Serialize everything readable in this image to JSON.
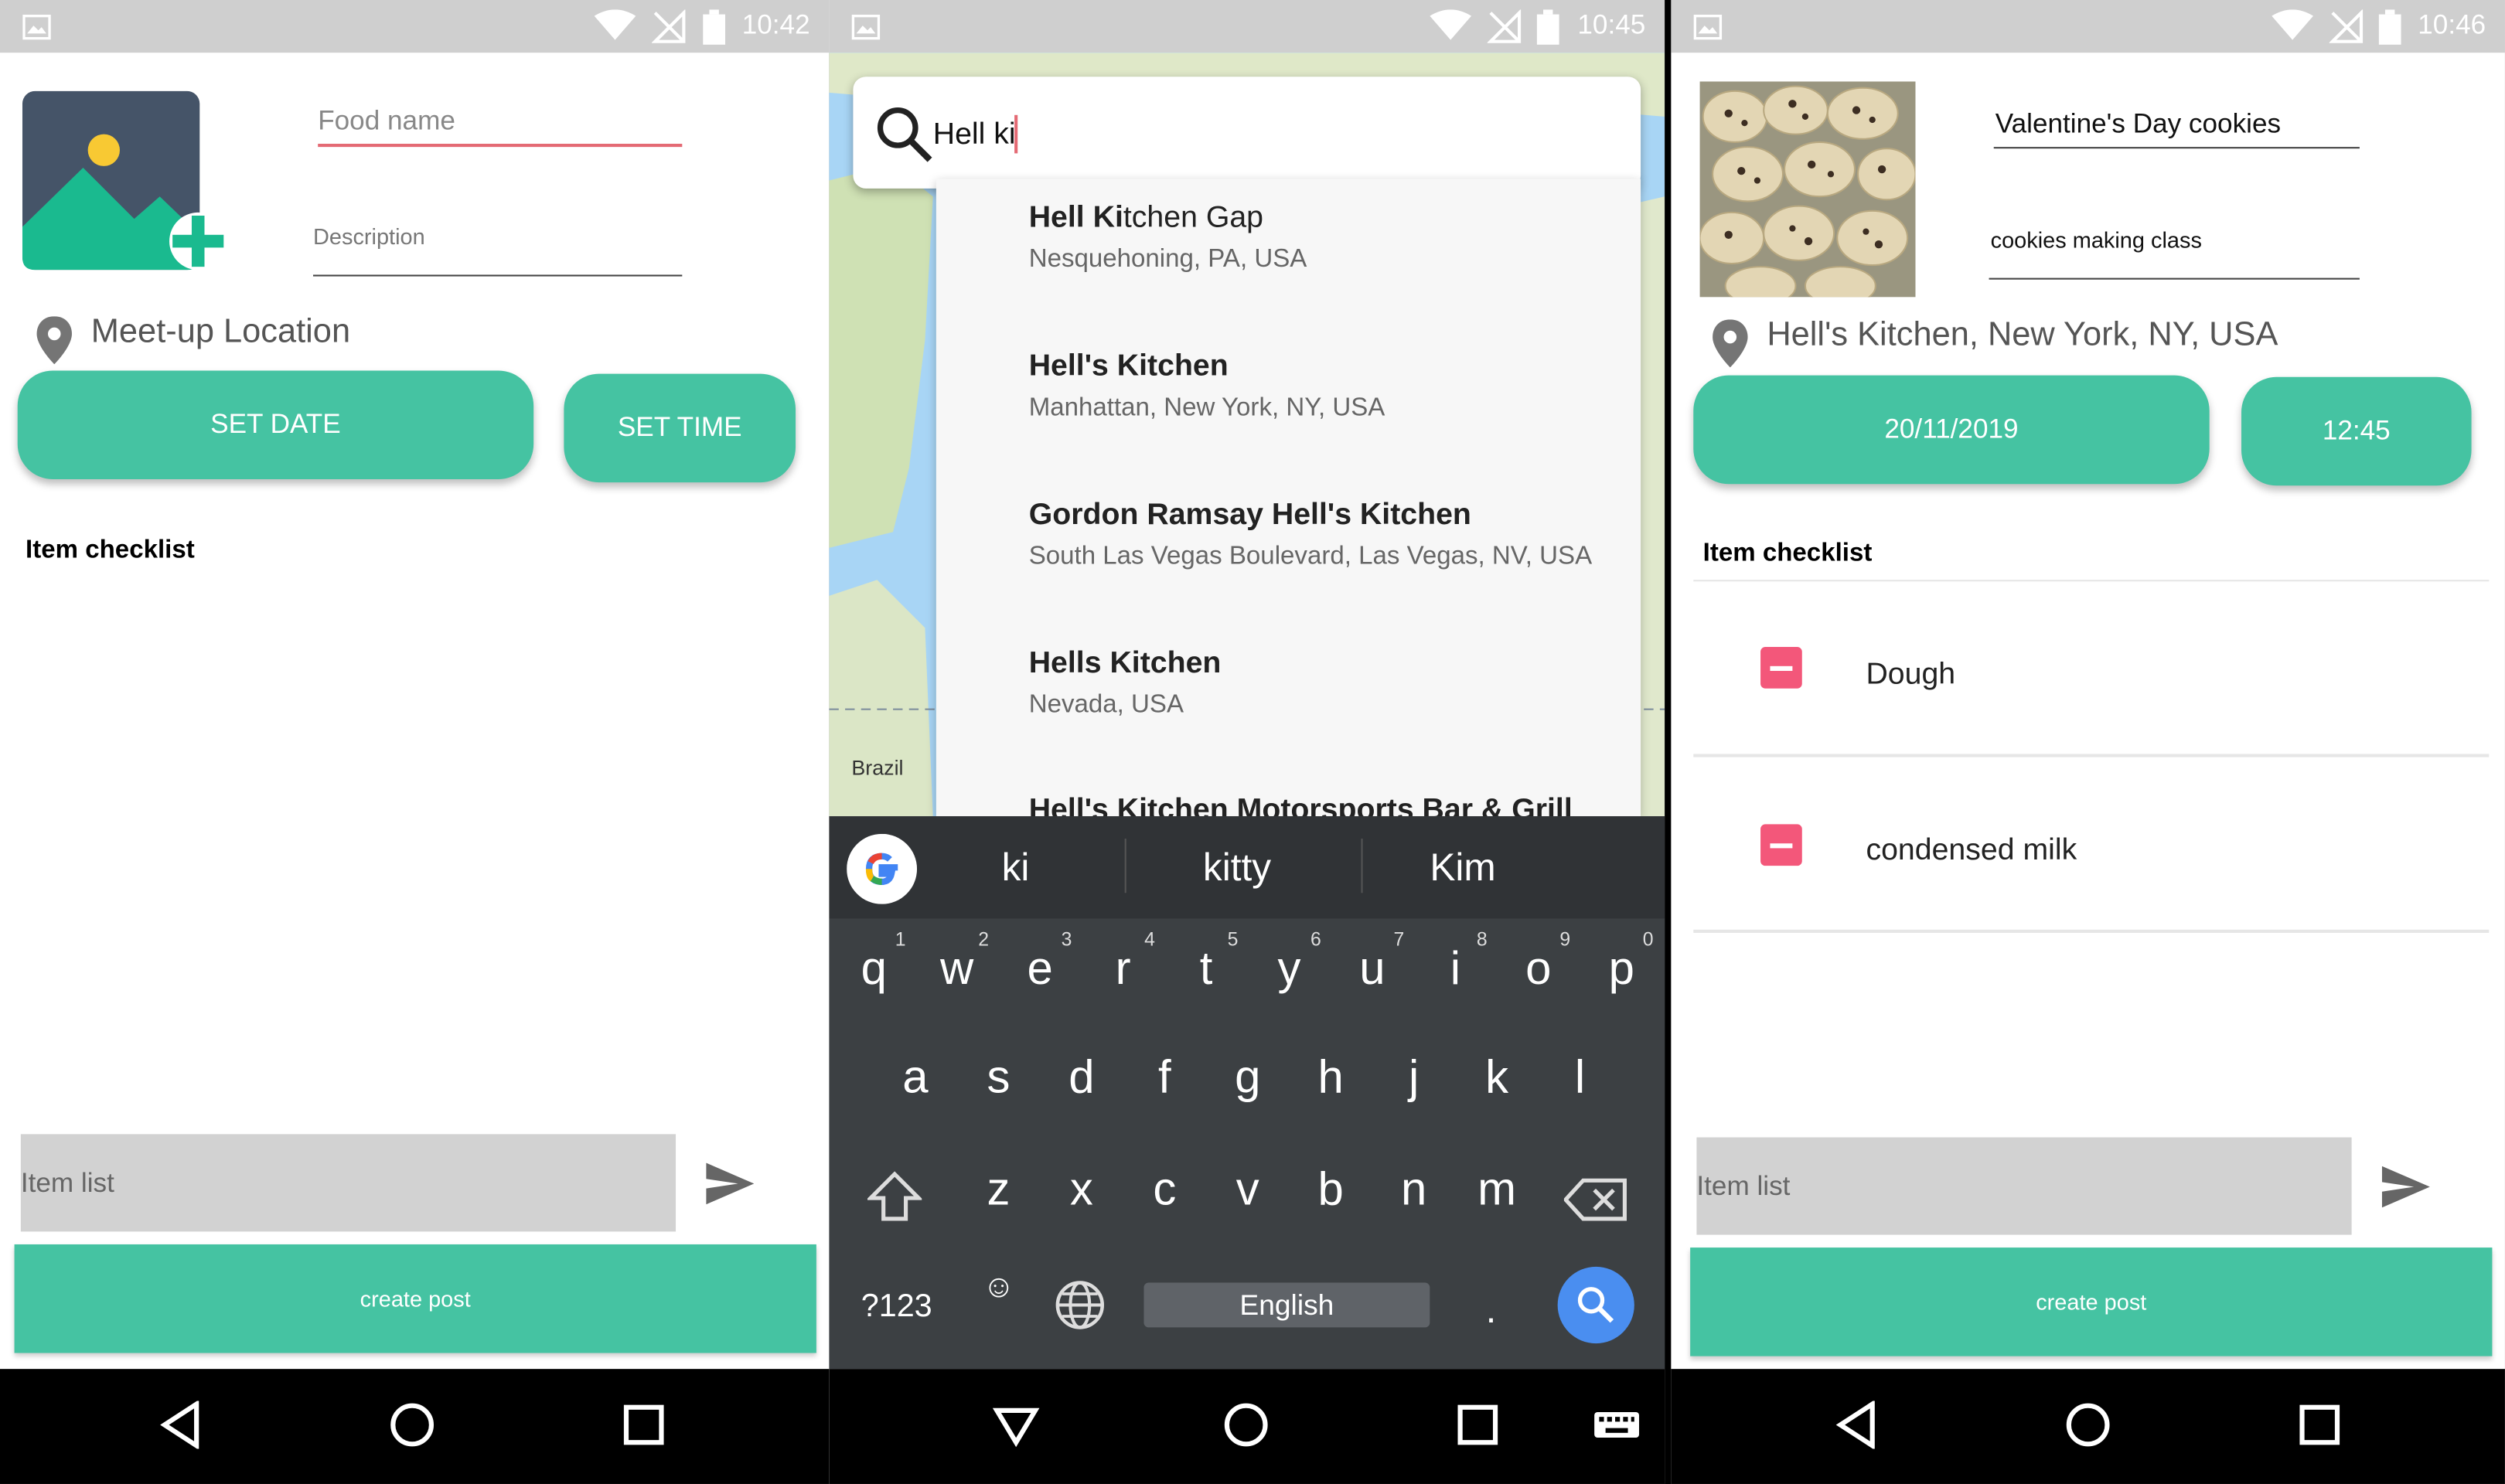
{
  "screens": [
    {
      "status_time": "10:42",
      "food_name_placeholder": "Food name",
      "description_placeholder": "Description",
      "location": "Meet-up Location",
      "set_date": "SET DATE",
      "set_time": "SET TIME",
      "checklist_title": "Item checklist",
      "item_list_placeholder": "Item list",
      "create_post": "create post"
    },
    {
      "status_time": "10:45",
      "search_query": "Hell ki",
      "suggestions": [
        {
          "bold": "Hell Ki",
          "rest": "tchen Gap",
          "sub": "Nesquehoning, PA, USA"
        },
        {
          "bold": "Hell's Kitchen",
          "rest": "",
          "sub": "Manhattan, New York, NY, USA"
        },
        {
          "bold": "Gordon Ramsay Hell's Kitchen",
          "rest": "",
          "sub": "South Las Vegas Boulevard, Las Vegas, NV, USA"
        },
        {
          "bold": "Hells Kitchen",
          "rest": "",
          "sub": "Nevada, USA"
        },
        {
          "bold": "Hell's Kitchen Motorsports Bar & Grill",
          "rest": "",
          "sub": ""
        }
      ],
      "map_label": "Brazil",
      "keyboard": {
        "suggestions": [
          "ki",
          "kitty",
          "Kim"
        ],
        "row1": [
          "q",
          "w",
          "e",
          "r",
          "t",
          "y",
          "u",
          "i",
          "o",
          "p"
        ],
        "row1_nums": [
          "1",
          "2",
          "3",
          "4",
          "5",
          "6",
          "7",
          "8",
          "9",
          "0"
        ],
        "row2": [
          "a",
          "s",
          "d",
          "f",
          "g",
          "h",
          "j",
          "k",
          "l"
        ],
        "row3": [
          "z",
          "x",
          "c",
          "v",
          "b",
          "n",
          "m"
        ],
        "symbols": "?123",
        "space": "English",
        "period": "."
      }
    },
    {
      "status_time": "10:46",
      "food_name": "Valentine's Day cookies",
      "description": "cookies making class",
      "location": "Hell's Kitchen, New York, NY, USA",
      "date": "20/11/2019",
      "time": "12:45",
      "checklist_title": "Item checklist",
      "items": [
        "Dough",
        "condensed milk"
      ],
      "item_list_placeholder": "Item list",
      "create_post": "create post"
    }
  ],
  "colors": {
    "accent": "#45c3a2",
    "error_underline": "#e46a74",
    "remove": "#f3577a",
    "search_fab": "#4a8ef0"
  }
}
